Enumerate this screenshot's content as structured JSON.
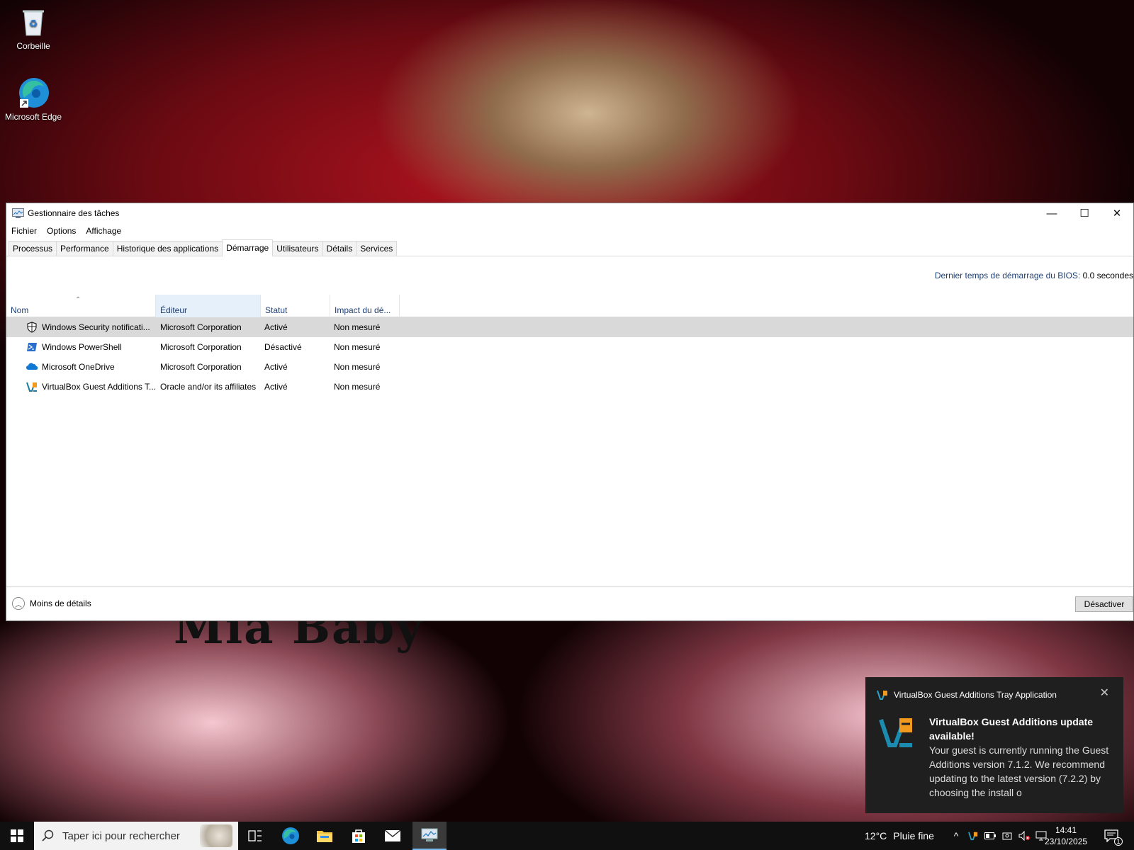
{
  "desktop": {
    "icons": [
      {
        "label": "Corbeille",
        "icon": "recycle-bin-icon"
      },
      {
        "label": "Microsoft Edge",
        "icon": "edge-icon"
      }
    ],
    "wallpaper_text": "Mia Baby"
  },
  "window": {
    "title": "Gestionnaire des tâches",
    "controls": {
      "minimize": "—",
      "maximize": "☐",
      "close": "✕"
    },
    "menu": [
      "Fichier",
      "Options",
      "Affichage"
    ],
    "tabs": [
      "Processus",
      "Performance",
      "Historique des applications",
      "Démarrage",
      "Utilisateurs",
      "Détails",
      "Services"
    ],
    "active_tab": "Démarrage",
    "bios_label": "Dernier temps de démarrage du BIOS:",
    "bios_value": "0.0 secondes",
    "columns": [
      "Nom",
      "Éditeur",
      "Statut",
      "Impact du dé..."
    ],
    "rows": [
      {
        "name": "Windows Security notificati...",
        "publisher": "Microsoft Corporation",
        "status": "Activé",
        "impact": "Non mesuré",
        "icon": "shield-icon"
      },
      {
        "name": "Windows PowerShell",
        "publisher": "Microsoft Corporation",
        "status": "Désactivé",
        "impact": "Non mesuré",
        "icon": "powershell-icon"
      },
      {
        "name": "Microsoft OneDrive",
        "publisher": "Microsoft Corporation",
        "status": "Activé",
        "impact": "Non mesuré",
        "icon": "onedrive-icon"
      },
      {
        "name": "VirtualBox Guest Additions T...",
        "publisher": "Oracle and/or its affiliates",
        "status": "Activé",
        "impact": "Non mesuré",
        "icon": "virtualbox-icon"
      }
    ],
    "fewer_details": "Moins de détails",
    "disable_button": "Désactiver"
  },
  "toast": {
    "app": "VirtualBox Guest Additions Tray Application",
    "title": "VirtualBox Guest Additions update available!",
    "message": "Your guest is currently running the Guest Additions version 7.1.2. We recommend updating to the latest version (7.2.2) by choosing the install o"
  },
  "taskbar": {
    "search_placeholder": "Taper ici pour rechercher",
    "weather_temp": "12°C",
    "weather_text": "Pluie fine",
    "time": "14:41",
    "date": "23/10/2025",
    "notification_count": "1"
  },
  "colors": {
    "accent": "#1e3f74",
    "selected_row": "#d9d9d9",
    "toast_bg": "#1f1f1f",
    "taskbar_bg": "#101010"
  }
}
